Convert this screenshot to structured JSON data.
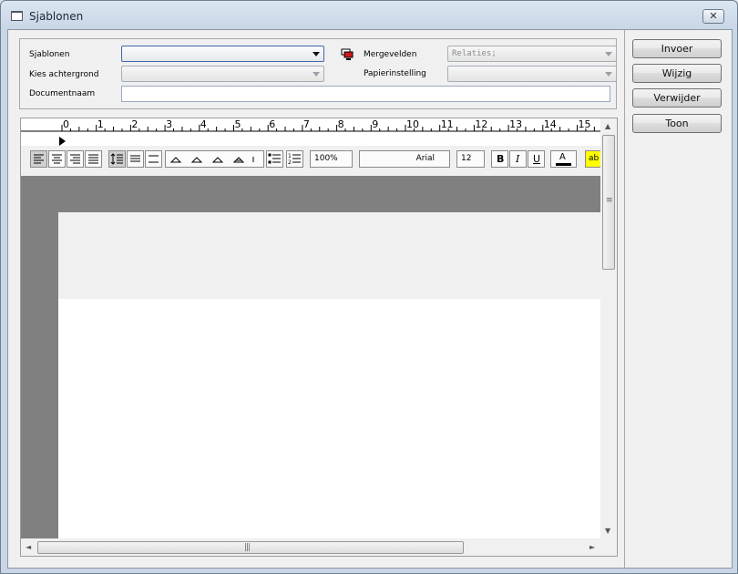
{
  "window": {
    "title": "Sjablonen",
    "close_label": "✕"
  },
  "form": {
    "sjablonen_label": "Sjablonen",
    "achtergrond_label": "Kies achtergrond",
    "documentnaam_label": "Documentnaam",
    "mergevelden_label": "Mergevelden",
    "mergevelden_value": "Relaties;",
    "papierinstelling_label": "Papierinstelling"
  },
  "buttons": {
    "invoer": "Invoer",
    "wijzig": "Wijzig",
    "verwijder": "Verwijder",
    "toon": "Toon"
  },
  "ruler": {
    "numbers": [
      "0",
      "1",
      "2",
      "3",
      "4",
      "5",
      "6",
      "7",
      "8",
      "9",
      "10",
      "11",
      "12",
      "13",
      "14",
      "15"
    ]
  },
  "toolbar": {
    "zoom": "100%",
    "font": "Arial",
    "size": "12",
    "bold": "B",
    "italic": "I",
    "underline": "U",
    "color": "A",
    "highlight": "ab"
  },
  "scrollbar": {
    "up": "▲",
    "down": "▼",
    "left": "◄",
    "right": "►",
    "grip_v": "≡",
    "grip_h": "|||"
  },
  "colors": {
    "highlight": "#ffff00",
    "font_color_bar": "#000000",
    "doc_background": "#808080"
  }
}
